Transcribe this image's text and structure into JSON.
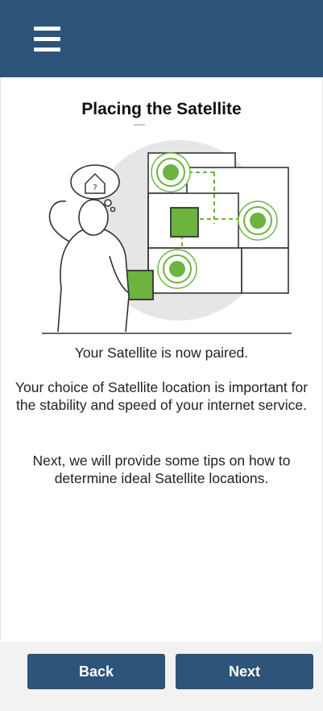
{
  "header": {
    "menu_icon": "hamburger-menu-icon",
    "background_color": "#2e5479"
  },
  "page": {
    "title": "Placing the Satellite"
  },
  "illustration": {
    "icon": "satellite-placement-illustration",
    "accent_color": "#6cb33f"
  },
  "messages": {
    "paired": "Your Satellite is now paired.",
    "importance": "Your choice of Satellite location is important for the stability and speed of your internet service.",
    "next_tips": "Next, we will provide some tips on how to determine ideal Satellite locations."
  },
  "footer": {
    "back_label": "Back",
    "next_label": "Next",
    "button_color": "#2e5479"
  }
}
